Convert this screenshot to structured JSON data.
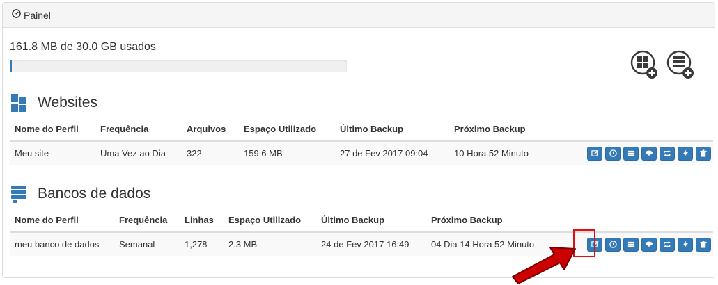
{
  "panel": {
    "title": "Painel"
  },
  "usage": {
    "text": "161.8 MB de 30.0 GB usados",
    "used_fraction": 0.0053
  },
  "websites": {
    "title": "Websites",
    "columns": [
      "Nome do Perfil",
      "Frequência",
      "Arquivos",
      "Espaço Utilizado",
      "Último Backup",
      "Próximo Backup"
    ],
    "rows": [
      {
        "name": "Meu site",
        "frequency": "Uma Vez ao Dia",
        "count": "322",
        "space": "159.6 MB",
        "last": "27 de Fev 2017 09:04",
        "next": "10 Hora 52 Minuto"
      }
    ]
  },
  "databases": {
    "title": "Bancos de dados",
    "columns": [
      "Nome do Perfil",
      "Frequência",
      "Linhas",
      "Espaço Utilizado",
      "Último Backup",
      "Próximo Backup"
    ],
    "rows": [
      {
        "name": "meu banco de dados",
        "frequency": "Semanal",
        "count": "1,278",
        "space": "2.3 MB",
        "last": "24 de Fev 2017 16:49",
        "next": "04 Dia 14 Hora 52 Minuto"
      }
    ]
  },
  "row_actions": [
    "edit-icon",
    "clock-icon",
    "list-icon",
    "cloud-download-icon",
    "refresh-icon",
    "bolt-icon",
    "trash-icon"
  ],
  "colors": {
    "primary": "#337ab7",
    "highlight": "#e01010",
    "dark_icon": "#3a3a3a"
  }
}
